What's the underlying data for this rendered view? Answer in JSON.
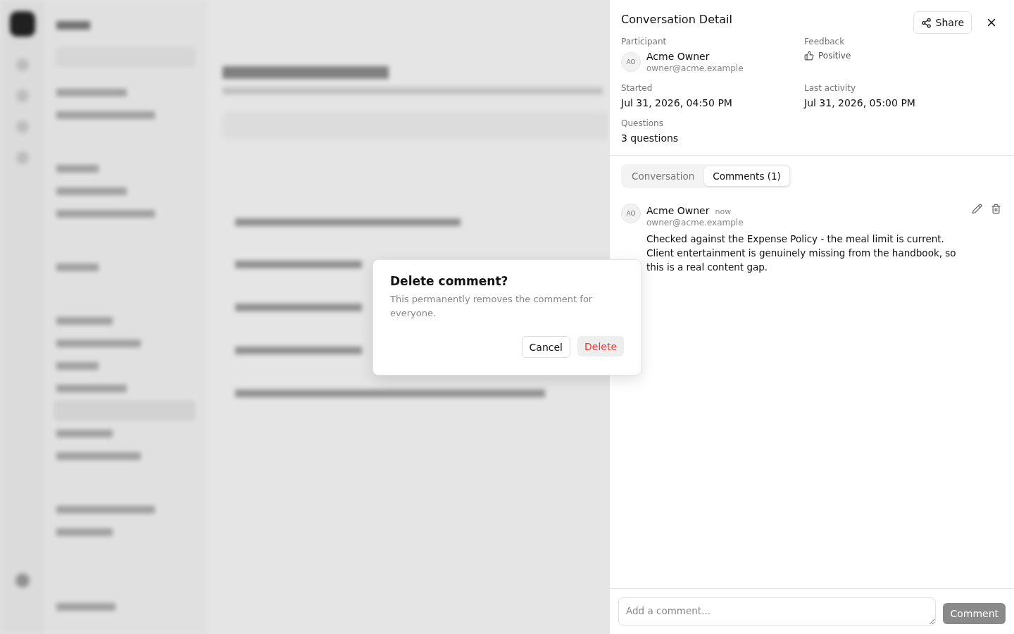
{
  "panel": {
    "title": "Conversation Detail",
    "share_button": "Share",
    "fields": [
      {
        "kind": "person",
        "label": "Participant",
        "initials": "AO",
        "name": "Acme Owner",
        "email": "owner@acme.example"
      },
      {
        "kind": "feedback",
        "label": "Feedback",
        "value": "Positive"
      },
      {
        "kind": "text",
        "label": "Started",
        "value": "Jul 31, 2026, 04:50 PM"
      },
      {
        "kind": "text",
        "label": "Last activity",
        "value": "Jul 31, 2026, 05:00 PM"
      },
      {
        "kind": "text",
        "label": "Questions",
        "value": "3 questions"
      }
    ],
    "tabs": [
      {
        "label": "Conversation",
        "selected": false
      },
      {
        "label": "Comments (1)",
        "selected": true
      }
    ],
    "comments": [
      {
        "initials": "AO",
        "author": "Acme Owner",
        "time": "now",
        "email": "owner@acme.example",
        "body": "Checked against the Expense Policy - the meal limit is current. Client entertainment is genuinely missing from the handbook, so this is a real content gap."
      }
    ],
    "composer": {
      "placeholder": "Add a comment...",
      "button": "Comment",
      "disabled": true
    }
  },
  "dialog": {
    "title": "Delete comment?",
    "message": "This permanently removes the comment for everyone.",
    "cancel": "Cancel",
    "confirm": "Delete"
  }
}
